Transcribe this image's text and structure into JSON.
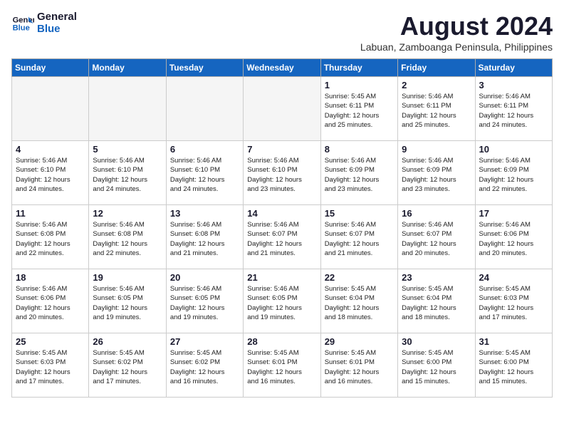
{
  "logo": {
    "line1": "General",
    "line2": "Blue"
  },
  "title": "August 2024",
  "location": "Labuan, Zamboanga Peninsula, Philippines",
  "days_of_week": [
    "Sunday",
    "Monday",
    "Tuesday",
    "Wednesday",
    "Thursday",
    "Friday",
    "Saturday"
  ],
  "weeks": [
    [
      {
        "day": "",
        "info": ""
      },
      {
        "day": "",
        "info": ""
      },
      {
        "day": "",
        "info": ""
      },
      {
        "day": "",
        "info": ""
      },
      {
        "day": "1",
        "info": "Sunrise: 5:45 AM\nSunset: 6:11 PM\nDaylight: 12 hours\nand 25 minutes."
      },
      {
        "day": "2",
        "info": "Sunrise: 5:46 AM\nSunset: 6:11 PM\nDaylight: 12 hours\nand 25 minutes."
      },
      {
        "day": "3",
        "info": "Sunrise: 5:46 AM\nSunset: 6:11 PM\nDaylight: 12 hours\nand 24 minutes."
      }
    ],
    [
      {
        "day": "4",
        "info": "Sunrise: 5:46 AM\nSunset: 6:10 PM\nDaylight: 12 hours\nand 24 minutes."
      },
      {
        "day": "5",
        "info": "Sunrise: 5:46 AM\nSunset: 6:10 PM\nDaylight: 12 hours\nand 24 minutes."
      },
      {
        "day": "6",
        "info": "Sunrise: 5:46 AM\nSunset: 6:10 PM\nDaylight: 12 hours\nand 24 minutes."
      },
      {
        "day": "7",
        "info": "Sunrise: 5:46 AM\nSunset: 6:10 PM\nDaylight: 12 hours\nand 23 minutes."
      },
      {
        "day": "8",
        "info": "Sunrise: 5:46 AM\nSunset: 6:09 PM\nDaylight: 12 hours\nand 23 minutes."
      },
      {
        "day": "9",
        "info": "Sunrise: 5:46 AM\nSunset: 6:09 PM\nDaylight: 12 hours\nand 23 minutes."
      },
      {
        "day": "10",
        "info": "Sunrise: 5:46 AM\nSunset: 6:09 PM\nDaylight: 12 hours\nand 22 minutes."
      }
    ],
    [
      {
        "day": "11",
        "info": "Sunrise: 5:46 AM\nSunset: 6:08 PM\nDaylight: 12 hours\nand 22 minutes."
      },
      {
        "day": "12",
        "info": "Sunrise: 5:46 AM\nSunset: 6:08 PM\nDaylight: 12 hours\nand 22 minutes."
      },
      {
        "day": "13",
        "info": "Sunrise: 5:46 AM\nSunset: 6:08 PM\nDaylight: 12 hours\nand 21 minutes."
      },
      {
        "day": "14",
        "info": "Sunrise: 5:46 AM\nSunset: 6:07 PM\nDaylight: 12 hours\nand 21 minutes."
      },
      {
        "day": "15",
        "info": "Sunrise: 5:46 AM\nSunset: 6:07 PM\nDaylight: 12 hours\nand 21 minutes."
      },
      {
        "day": "16",
        "info": "Sunrise: 5:46 AM\nSunset: 6:07 PM\nDaylight: 12 hours\nand 20 minutes."
      },
      {
        "day": "17",
        "info": "Sunrise: 5:46 AM\nSunset: 6:06 PM\nDaylight: 12 hours\nand 20 minutes."
      }
    ],
    [
      {
        "day": "18",
        "info": "Sunrise: 5:46 AM\nSunset: 6:06 PM\nDaylight: 12 hours\nand 20 minutes."
      },
      {
        "day": "19",
        "info": "Sunrise: 5:46 AM\nSunset: 6:05 PM\nDaylight: 12 hours\nand 19 minutes."
      },
      {
        "day": "20",
        "info": "Sunrise: 5:46 AM\nSunset: 6:05 PM\nDaylight: 12 hours\nand 19 minutes."
      },
      {
        "day": "21",
        "info": "Sunrise: 5:46 AM\nSunset: 6:05 PM\nDaylight: 12 hours\nand 19 minutes."
      },
      {
        "day": "22",
        "info": "Sunrise: 5:45 AM\nSunset: 6:04 PM\nDaylight: 12 hours\nand 18 minutes."
      },
      {
        "day": "23",
        "info": "Sunrise: 5:45 AM\nSunset: 6:04 PM\nDaylight: 12 hours\nand 18 minutes."
      },
      {
        "day": "24",
        "info": "Sunrise: 5:45 AM\nSunset: 6:03 PM\nDaylight: 12 hours\nand 17 minutes."
      }
    ],
    [
      {
        "day": "25",
        "info": "Sunrise: 5:45 AM\nSunset: 6:03 PM\nDaylight: 12 hours\nand 17 minutes."
      },
      {
        "day": "26",
        "info": "Sunrise: 5:45 AM\nSunset: 6:02 PM\nDaylight: 12 hours\nand 17 minutes."
      },
      {
        "day": "27",
        "info": "Sunrise: 5:45 AM\nSunset: 6:02 PM\nDaylight: 12 hours\nand 16 minutes."
      },
      {
        "day": "28",
        "info": "Sunrise: 5:45 AM\nSunset: 6:01 PM\nDaylight: 12 hours\nand 16 minutes."
      },
      {
        "day": "29",
        "info": "Sunrise: 5:45 AM\nSunset: 6:01 PM\nDaylight: 12 hours\nand 16 minutes."
      },
      {
        "day": "30",
        "info": "Sunrise: 5:45 AM\nSunset: 6:00 PM\nDaylight: 12 hours\nand 15 minutes."
      },
      {
        "day": "31",
        "info": "Sunrise: 5:45 AM\nSunset: 6:00 PM\nDaylight: 12 hours\nand 15 minutes."
      }
    ]
  ]
}
